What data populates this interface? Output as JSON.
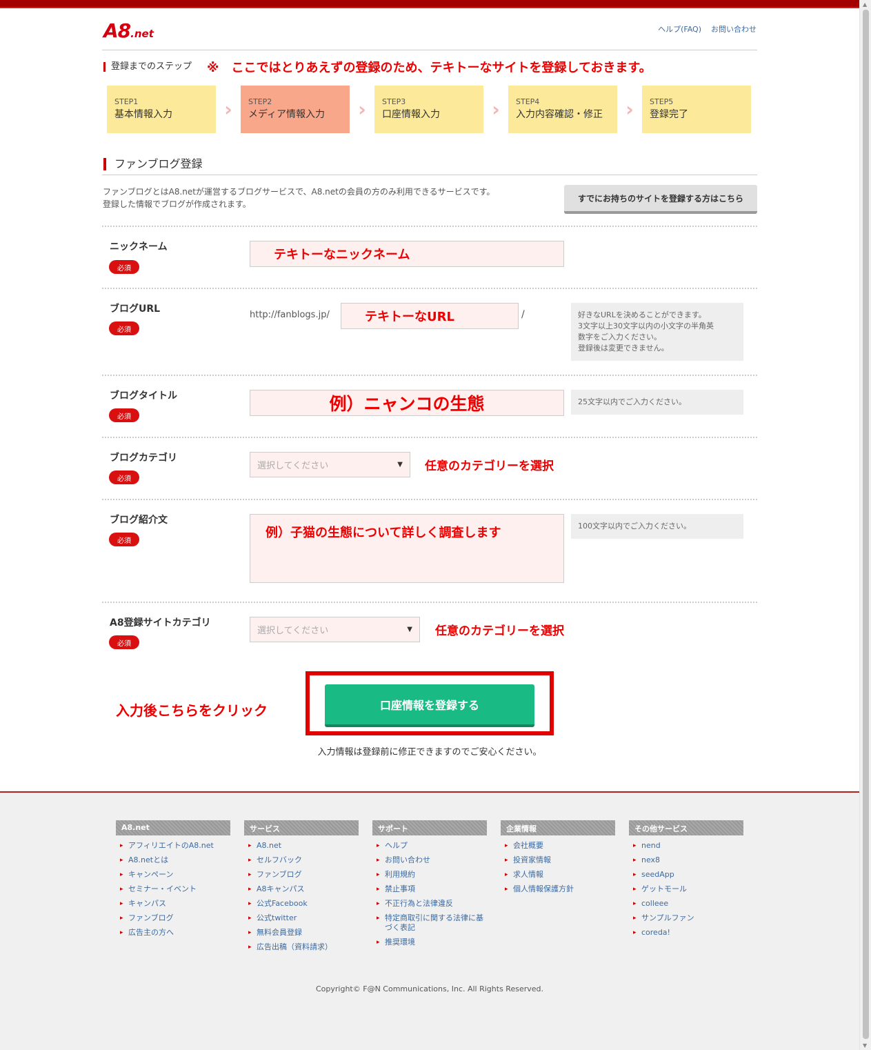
{
  "header": {
    "logo_main": "A8",
    "logo_sub": ".net",
    "links": [
      "ヘルプ(FAQ)",
      "お問い合わせ"
    ]
  },
  "steps": {
    "title": "登録までのステップ",
    "annotation": "※　ここではとりあえずの登録のため、テキトーなサイトを登録しておきます。",
    "items": [
      {
        "num": "STEP1",
        "label": "基本情報入力"
      },
      {
        "num": "STEP2",
        "label": "メディア情報入力"
      },
      {
        "num": "STEP3",
        "label": "口座情報入力"
      },
      {
        "num": "STEP4",
        "label": "入力内容確認・修正"
      },
      {
        "num": "STEP5",
        "label": "登録完了"
      }
    ]
  },
  "section": {
    "title": "ファンブログ登録",
    "intro_line1": "ファンブログとはA8.netが運営するブログサービスで、A8.netの会員の方のみ利用できるサービスです。",
    "intro_line2": "登録した情報でブログが作成されます。",
    "existing_button": "すでにお持ちのサイトを登録する方はこちら"
  },
  "form": {
    "required": "必須",
    "nickname": {
      "label": "ニックネーム",
      "value": "テキトーなニックネーム"
    },
    "blog_url": {
      "label": "ブログURL",
      "prefix": "http://fanblogs.jp/",
      "value": "テキトーなURL",
      "suffix": "/",
      "hint1": "好きなURLを決めることができます。",
      "hint2": "3文字以上30文字以内の小文字の半角英",
      "hint3": "数字をご入力ください。",
      "hint4": "登録後は変更できません。"
    },
    "blog_title": {
      "label": "ブログタイトル",
      "value": "例）ニャンコの生態",
      "hint": "25文字以内でご入力ください。"
    },
    "blog_category": {
      "label": "ブログカテゴリ",
      "selected": "選択してください",
      "annotation": "任意のカテゴリーを選択"
    },
    "blog_intro": {
      "label": "ブログ紹介文",
      "value": "例）子猫の生態について詳しく調査します",
      "hint": "100文字以内でご入力ください。"
    },
    "site_category": {
      "label": "A8登録サイトカテゴリ",
      "selected": "選択してください",
      "annotation": "任意のカテゴリーを選択"
    }
  },
  "submit": {
    "annotation": "入力後こちらをクリック",
    "label": "口座情報を登録する",
    "note": "入力情報は登録前に修正できますのでご安心ください。"
  },
  "footer": {
    "columns": [
      {
        "title": "A8.net",
        "items": [
          "アフィリエイトのA8.net",
          "A8.netとは",
          "キャンペーン",
          "セミナー・イベント",
          "キャンパス",
          "ファンブログ",
          "広告主の方へ"
        ]
      },
      {
        "title": "サービス",
        "items": [
          "A8.net",
          "セルフバック",
          "ファンブログ",
          "A8キャンパス",
          "公式Facebook",
          "公式twitter",
          "無料会員登録",
          "広告出稿（資料請求）"
        ]
      },
      {
        "title": "サポート",
        "items": [
          "ヘルプ",
          "お問い合わせ",
          "利用規約",
          "禁止事項",
          "不正行為と法律違反",
          "特定商取引に関する法律に基づく表記",
          "推奨環境"
        ]
      },
      {
        "title": "企業情報",
        "items": [
          "会社概要",
          "投資家情報",
          "求人情報",
          "個人情報保護方針"
        ]
      },
      {
        "title": "その他サービス",
        "items": [
          "nend",
          "nex8",
          "seedApp",
          "ゲットモール",
          "colleee",
          "サンプルファン",
          "coreda!"
        ]
      }
    ],
    "copyright": "Copyright© F@N Communications, Inc. All Rights Reserved."
  },
  "colors": {
    "brand_red": "#d40010",
    "step_yellow": "#fcea9a",
    "step_active": "#f9a78b",
    "submit_green": "#1aba85",
    "annotation_red": "#e00000"
  }
}
